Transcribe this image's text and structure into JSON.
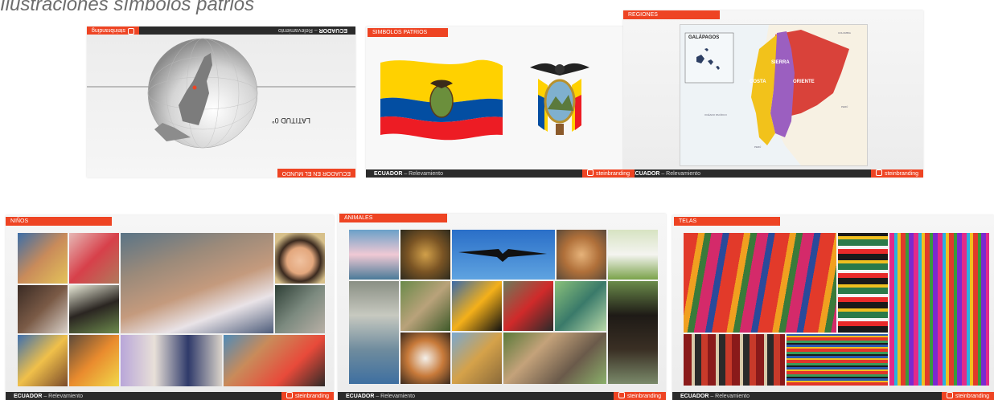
{
  "heading": "Ilustraciones símbolos patrios",
  "footer": {
    "brand": "ECUADOR",
    "section": " – Relevamiento",
    "logo_text": "steinbranding"
  },
  "slides": {
    "world": {
      "tag": "ECUADOR EN EL MUNDO",
      "latitude_label": "LATITUD 0°"
    },
    "symbols": {
      "tag": "SIMBOLOS PATRIOS"
    },
    "regions": {
      "tag": "REGIONES",
      "galapagos": "GALÁPAGOS",
      "sierra": "SIERRA",
      "costa": "COSTA",
      "oriente": "ORIENTE",
      "colombia": "COLOMBIA",
      "peru": "PERÚ",
      "ocean": "OCÉANO PACÍFICO",
      "peru2": "PERÚ"
    },
    "kids": {
      "tag": "NIÑOS"
    },
    "animals": {
      "tag": "ANIMALES"
    },
    "textiles": {
      "tag": "TELAS"
    }
  },
  "colors": {
    "accent": "#ee4423",
    "footer": "#2b2b2b",
    "flag_yellow": "#ffd100",
    "flag_blue": "#034ea2",
    "flag_red": "#ed1c24",
    "costa": "#f2c21b",
    "sierra": "#9b5fc0",
    "oriente": "#d9423a"
  }
}
